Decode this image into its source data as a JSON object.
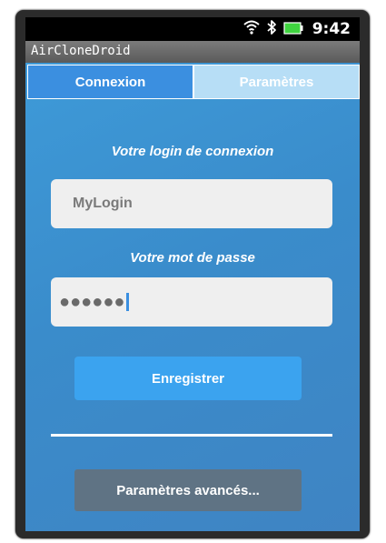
{
  "status_bar": {
    "time": "9:42",
    "icons": [
      "wifi-icon",
      "bluetooth-icon",
      "battery-icon"
    ]
  },
  "app": {
    "title": "AirCloneDroid"
  },
  "tabs": [
    {
      "label": "Connexion",
      "active": true
    },
    {
      "label": "Paramètres",
      "active": false
    }
  ],
  "login": {
    "label": "Votre login de connexion",
    "value": "MyLogin"
  },
  "password": {
    "label": "Votre mot de passe",
    "masked_value": "●●●●●●"
  },
  "buttons": {
    "save_label": "Enregistrer",
    "advanced_label": "Paramètres avancés..."
  },
  "colors": {
    "background": "#3a8ccb",
    "active_tab": "#3b8fe0",
    "inactive_tab": "#b7def6",
    "primary_button": "#3ba3ef",
    "secondary_button": "#5f7384",
    "battery": "#3fd43f"
  }
}
